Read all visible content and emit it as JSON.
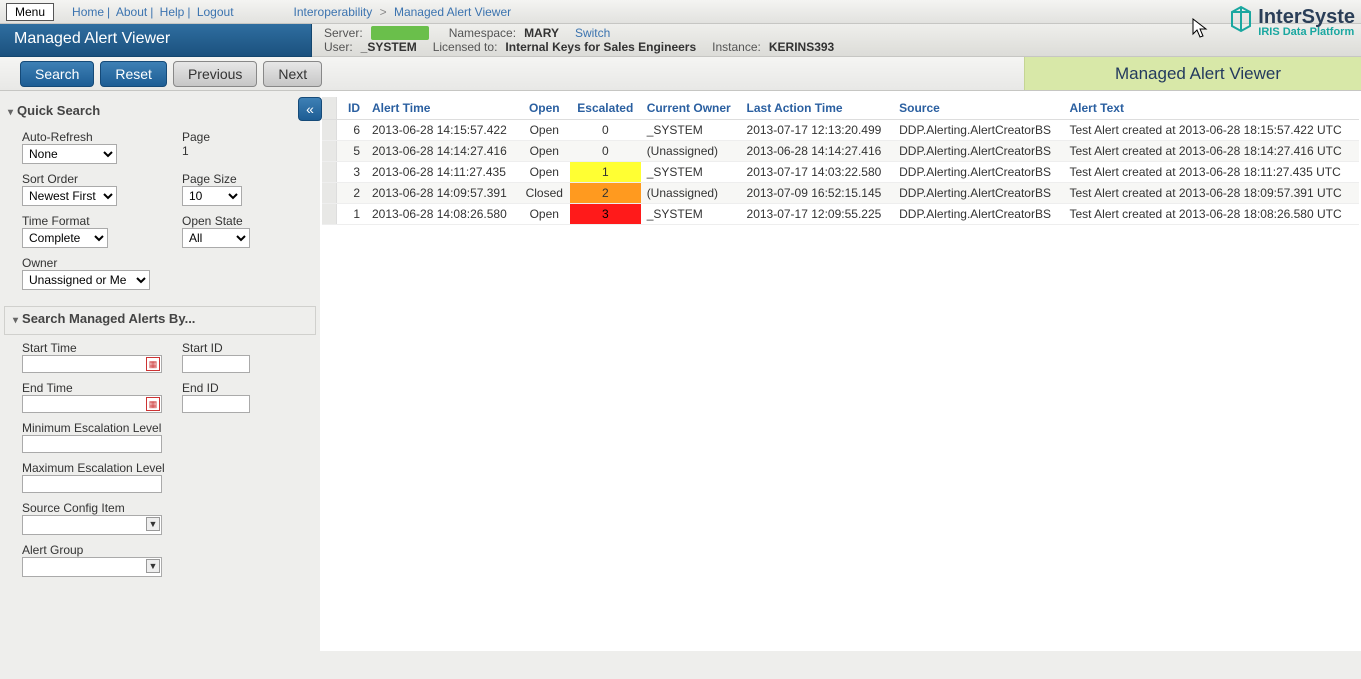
{
  "top": {
    "menu_btn": "Menu",
    "links": [
      "Home",
      "About",
      "Help",
      "Logout"
    ],
    "breadcrumb": [
      "Interoperability",
      "Managed Alert Viewer"
    ],
    "logo_name": "InterSyste",
    "logo_sub": "IRIS Data Platform"
  },
  "header": {
    "title": "Managed Alert Viewer",
    "server_lbl": "Server:",
    "namespace_lbl": "Namespace:",
    "namespace": "MARY",
    "switch": "Switch",
    "user_lbl": "User:",
    "user": "_SYSTEM",
    "licensed_lbl": "Licensed to:",
    "licensed": "Internal Keys for Sales Engineers",
    "instance_lbl": "Instance:",
    "instance": "KERINS393"
  },
  "actions": {
    "search": "Search",
    "reset": "Reset",
    "previous": "Previous",
    "next": "Next",
    "caption": "Managed Alert Viewer"
  },
  "quick": {
    "title": "Quick Search",
    "auto_refresh_lbl": "Auto-Refresh",
    "auto_refresh": "None",
    "page_lbl": "Page",
    "page": "1",
    "sort_lbl": "Sort Order",
    "sort": "Newest First",
    "page_size_lbl": "Page Size",
    "page_size": "10",
    "time_fmt_lbl": "Time Format",
    "time_fmt": "Complete",
    "open_state_lbl": "Open State",
    "open_state": "All",
    "owner_lbl": "Owner",
    "owner": "Unassigned or Me"
  },
  "adv": {
    "title": "Search Managed Alerts By...",
    "start_time": "Start Time",
    "end_time": "End Time",
    "start_id": "Start ID",
    "end_id": "End ID",
    "min_esc": "Minimum Escalation Level",
    "max_esc": "Maximum Escalation Level",
    "src_cfg": "Source Config Item",
    "alert_group": "Alert Group"
  },
  "grid": {
    "cols": [
      "ID",
      "Alert Time",
      "Open",
      "Escalated",
      "Current Owner",
      "Last Action Time",
      "Source",
      "Alert Text"
    ],
    "rows": [
      {
        "id": "6",
        "time": "2013-06-28 14:15:57.422",
        "open": "Open",
        "esc": "0",
        "esc_cls": "esc-0",
        "owner": "_SYSTEM",
        "last": "2013-07-17 12:13:20.499",
        "src": "DDP.Alerting.AlertCreatorBS",
        "txt": "Test Alert created at 2013-06-28 18:15:57.422 UTC"
      },
      {
        "id": "5",
        "time": "2013-06-28 14:14:27.416",
        "open": "Open",
        "esc": "0",
        "esc_cls": "esc-0",
        "owner": "(Unassigned)",
        "last": "2013-06-28 14:14:27.416",
        "src": "DDP.Alerting.AlertCreatorBS",
        "txt": "Test Alert created at 2013-06-28 18:14:27.416 UTC"
      },
      {
        "id": "3",
        "time": "2013-06-28 14:11:27.435",
        "open": "Open",
        "esc": "1",
        "esc_cls": "esc-1",
        "owner": "_SYSTEM",
        "last": "2013-07-17 14:03:22.580",
        "src": "DDP.Alerting.AlertCreatorBS",
        "txt": "Test Alert created at 2013-06-28 18:11:27.435 UTC"
      },
      {
        "id": "2",
        "time": "2013-06-28 14:09:57.391",
        "open": "Closed",
        "esc": "2",
        "esc_cls": "esc-2",
        "owner": "(Unassigned)",
        "last": "2013-07-09 16:52:15.145",
        "src": "DDP.Alerting.AlertCreatorBS",
        "txt": "Test Alert created at 2013-06-28 18:09:57.391 UTC"
      },
      {
        "id": "1",
        "time": "2013-06-28 14:08:26.580",
        "open": "Open",
        "esc": "3",
        "esc_cls": "esc-3",
        "owner": "_SYSTEM",
        "last": "2013-07-17 12:09:55.225",
        "src": "DDP.Alerting.AlertCreatorBS",
        "txt": "Test Alert created at 2013-06-28 18:08:26.580 UTC"
      }
    ]
  }
}
